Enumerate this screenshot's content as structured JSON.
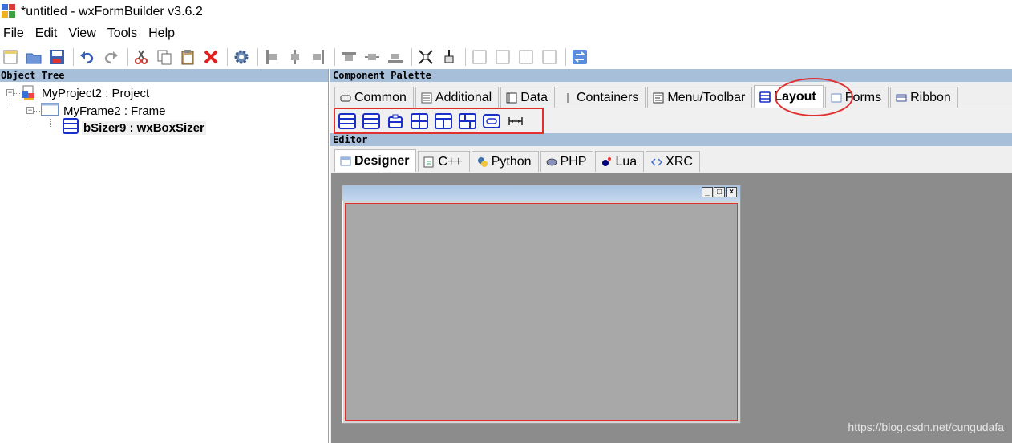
{
  "window": {
    "title": "*untitled - wxFormBuilder v3.6.2"
  },
  "menu": [
    "File",
    "Edit",
    "View",
    "Tools",
    "Help"
  ],
  "toolbar_icons": [
    "new-icon",
    "open-icon",
    "save-icon",
    "undo-icon",
    "redo-icon",
    "cut-icon",
    "copy-icon",
    "paste-icon",
    "delete-icon",
    "generate-code-icon",
    "align-left-icon",
    "align-center-h-icon",
    "align-right-icon",
    "align-top-icon",
    "align-center-v-icon",
    "align-bottom-icon",
    "expand-icon",
    "stretch-icon",
    "border-left-icon",
    "border-right-icon",
    "border-top-icon",
    "border-bottom-icon",
    "toggle-orientation-icon"
  ],
  "object_tree": {
    "header": "Object Tree",
    "nodes": [
      {
        "label": "MyProject2 : Project",
        "level": 0
      },
      {
        "label": "MyFrame2 : Frame",
        "level": 1
      },
      {
        "label": "bSizer9 : wxBoxSizer",
        "level": 2
      }
    ]
  },
  "component_palette": {
    "header": "Component Palette",
    "tabs": [
      "Common",
      "Additional",
      "Data",
      "Containers",
      "Menu/Toolbar",
      "Layout",
      "Forms",
      "Ribbon"
    ],
    "active_tab": "Layout",
    "layout_items": [
      "box-sizer-icon",
      "wrap-sizer-icon",
      "static-box-sizer-icon",
      "grid-sizer-icon",
      "flex-grid-sizer-icon",
      "grid-bag-sizer-icon",
      "std-dialog-button-sizer-icon",
      "spacer-icon"
    ]
  },
  "editor": {
    "header": "Editor",
    "tabs": [
      "Designer",
      "C++",
      "Python",
      "PHP",
      "Lua",
      "XRC"
    ],
    "active_tab": "Designer"
  },
  "watermark": "https://blog.csdn.net/cungudafa"
}
